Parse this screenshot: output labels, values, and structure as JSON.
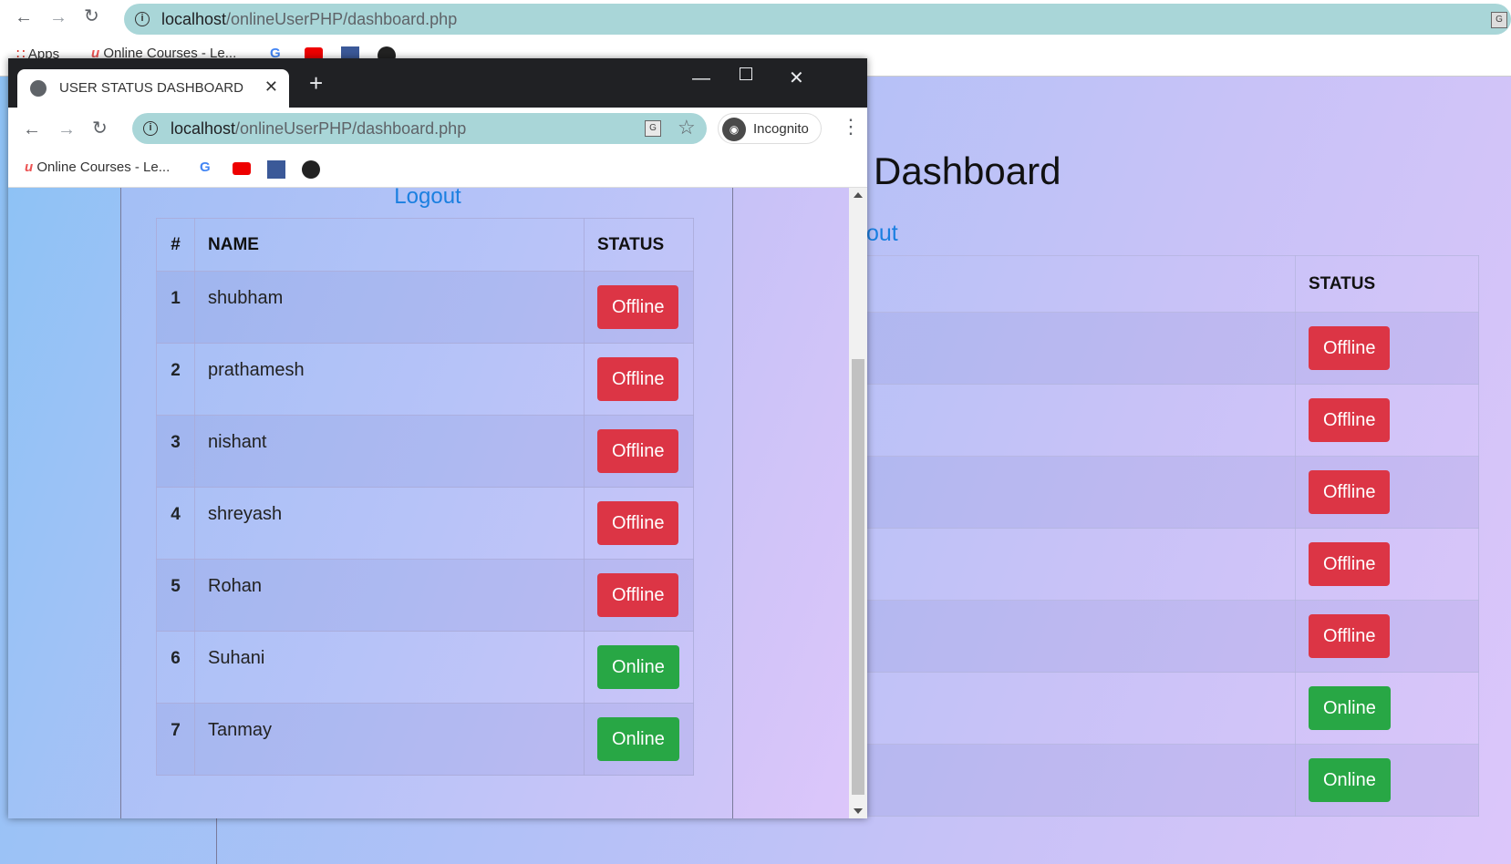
{
  "background_browser": {
    "url_host": "localhost",
    "url_path": "/onlineUserPHP/dashboard.php",
    "bookmarks": [
      "Apps",
      "Online Courses - Le..."
    ],
    "page_title_partial": "Dashboard",
    "logout_partial": "out",
    "table_header_status": "STATUS",
    "statuses": [
      "Offline",
      "Offline",
      "Offline",
      "Offline",
      "Offline",
      "Online",
      "Online"
    ]
  },
  "incognito_window": {
    "tab_title": "USER STATUS DASHBOARD",
    "url_host": "localhost",
    "url_path": "/onlineUserPHP/dashboard.php",
    "incognito_label": "Incognito",
    "bookmarks": [
      "Online Courses - Le..."
    ],
    "logout_label": "Logout",
    "table": {
      "headers": [
        "#",
        "NAME",
        "STATUS"
      ],
      "rows": [
        {
          "num": "1",
          "name": "shubham",
          "status": "Offline"
        },
        {
          "num": "2",
          "name": "prathamesh",
          "status": "Offline"
        },
        {
          "num": "3",
          "name": "nishant",
          "status": "Offline"
        },
        {
          "num": "4",
          "name": "shreyash",
          "status": "Offline"
        },
        {
          "num": "5",
          "name": "Rohan",
          "status": "Offline"
        },
        {
          "num": "6",
          "name": "Suhani",
          "status": "Online"
        },
        {
          "num": "7",
          "name": "Tanmay",
          "status": "Online"
        }
      ]
    }
  },
  "colors": {
    "offline": "#dc3545",
    "online": "#28a745",
    "link": "#1a7fe0",
    "omnibox": "#a9d6d8"
  }
}
